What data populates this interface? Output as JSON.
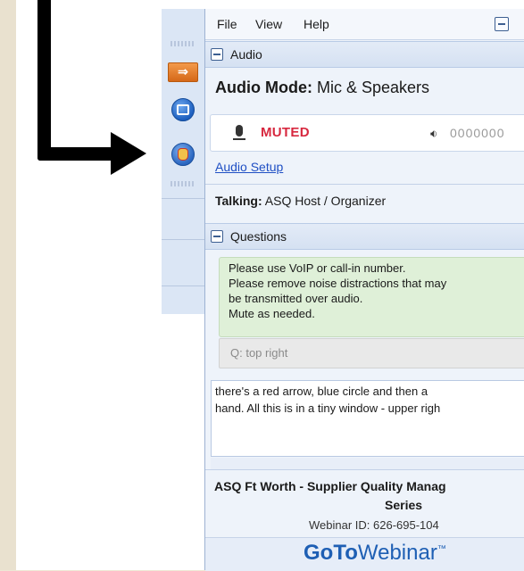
{
  "menu": {
    "items": [
      "File",
      "View",
      "Help"
    ]
  },
  "audio": {
    "section_title": "Audio",
    "mode_label": "Audio Mode:",
    "mode_value": "Mic & Speakers",
    "muted_label": "MUTED",
    "level_value": "0000000",
    "setup_link": "Audio Setup",
    "talking_label": "Talking:",
    "talking_value": "ASQ Host / Organizer"
  },
  "questions": {
    "section_title": "Questions",
    "notice_lines": [
      "Please use VoIP or call-in number.",
      "Please remove noise distractions that may",
      "be transmitted over audio.",
      "Mute as needed."
    ],
    "question_label": "Q: top right",
    "message_lines": [
      "there's a red arrow, blue circle and then a",
      "hand.  All this is in a tiny window - upper righ"
    ]
  },
  "event": {
    "title": "ASQ Ft Worth - Supplier Quality Manag",
    "series": "Series",
    "webinar_id": "Webinar ID: 626-695-104"
  },
  "brand": {
    "bold": "GoTo",
    "regular": "Webinar",
    "mark": "™"
  },
  "toolbar": {
    "icons": [
      "arrow-icon",
      "screen-icon",
      "raise-hand-icon"
    ]
  },
  "colors": {
    "muted": "#d7283f",
    "link": "#1f4fc4",
    "brand": "#1e5fb4",
    "question_bg": "#dff0d8"
  }
}
